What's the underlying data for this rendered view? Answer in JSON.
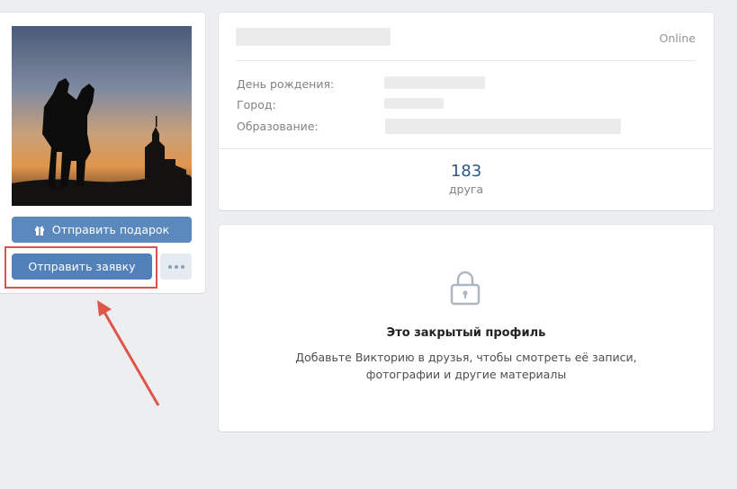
{
  "profile": {
    "online_status": "Online",
    "info_labels": {
      "birthday": "День рождения:",
      "city": "Город:",
      "education": "Образование:"
    },
    "friends": {
      "count": "183",
      "label": "друга"
    }
  },
  "actions": {
    "gift_label": "Отправить подарок",
    "request_label": "Отправить заявку"
  },
  "closed_profile": {
    "title": "Это закрытый профиль",
    "description": "Добавьте Викторию в друзья, чтобы смотреть её записи, фотографии и другие материалы"
  },
  "colors": {
    "accent_button": "#5181b8",
    "highlight": "#d9534f",
    "link": "#2a5885"
  }
}
